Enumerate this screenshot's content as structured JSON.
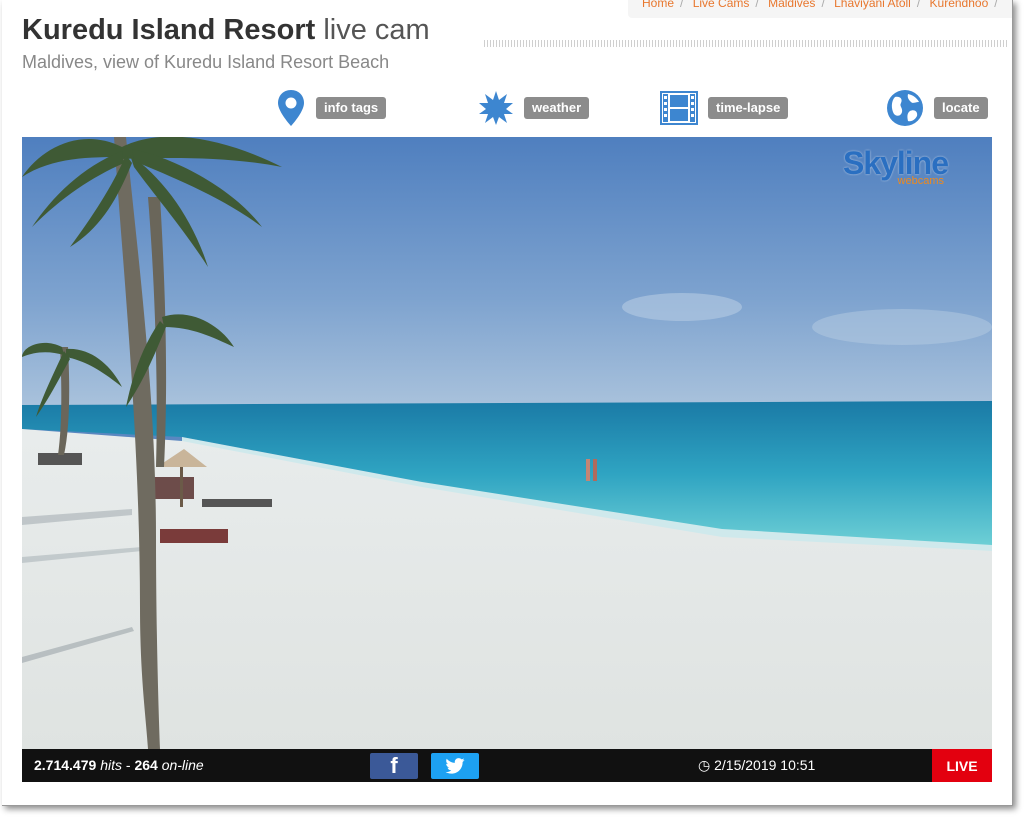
{
  "header": {
    "title_bold": "Kuredu Island Resort",
    "title_light": "live cam",
    "subtitle": "Maldives, view of Kuredu Island Resort Beach"
  },
  "breadcrumb": [
    "Home",
    "Live Cams",
    "Maldives",
    "Lhaviyani Atoll",
    "Kurendhoo"
  ],
  "tools": {
    "info_tags": "info tags",
    "weather": "weather",
    "time_lapse": "time-lapse",
    "locate": "locate"
  },
  "player": {
    "brand": "Skyline",
    "brand_sub": "webcams",
    "hits": "2.714.479",
    "hits_label": "hits",
    "online": "264",
    "online_label": "on-line",
    "datetime": "2/15/2019 10:51",
    "live": "LIVE",
    "facebook": "f"
  },
  "colors": {
    "accent_blue": "#2a6fc1",
    "breadcrumb_orange": "#e8772e",
    "live_red": "#e3000f"
  },
  "icons": [
    "map-pin-icon",
    "weather-burst-icon",
    "film-icon",
    "globe-icon",
    "clock-icon",
    "twitter-icon"
  ]
}
